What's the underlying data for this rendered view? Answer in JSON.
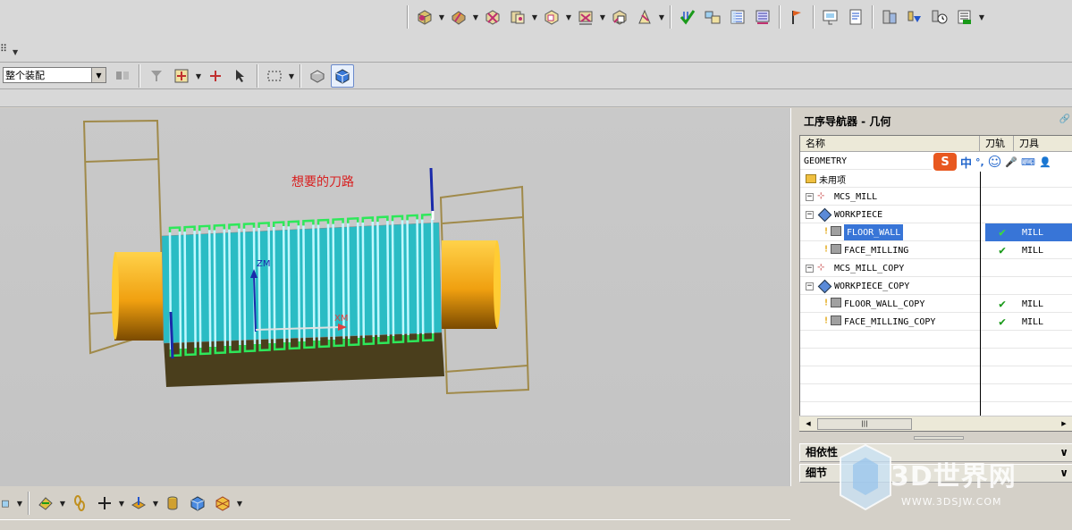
{
  "toolbar_top": {
    "icons": [
      "create-geometry-icon",
      "create-operation-icon",
      "delete-icon",
      "copy-icon",
      "insert-group-icon",
      "tool-icon",
      "method-icon",
      "cut-icon",
      "generate-toolpath-icon",
      "replay-toolpath-icon",
      "list-toolpath-icon",
      "postprocess-icon",
      "flag-icon",
      "shop-doc-icon",
      "output-doc-icon",
      "verify-icon",
      "simulate-icon",
      "clock-icon",
      "info-icon"
    ]
  },
  "toolbar_row2": {
    "assembly_selector_value": "整个装配"
  },
  "viewport": {
    "annotation": "想要的刀路",
    "axis_z": "ZM",
    "axis_x": "XM"
  },
  "navigator": {
    "title": "工序导航器 - 几何",
    "columns": {
      "name": "名称",
      "path": "刀轨",
      "tool": "刀具"
    },
    "ime": {
      "zh": "中",
      "punct": "°,"
    },
    "rows": [
      {
        "name": "GEOMETRY",
        "level": 0,
        "path": "",
        "tool": ""
      },
      {
        "name": "未用项",
        "level": 1,
        "path": "",
        "tool": ""
      },
      {
        "name": "MCS_MILL",
        "level": 1,
        "path": "",
        "tool": ""
      },
      {
        "name": "WORKPIECE",
        "level": 2,
        "path": "",
        "tool": ""
      },
      {
        "name": "FLOOR_WALL",
        "level": 3,
        "path": "✔",
        "tool": "MILL"
      },
      {
        "name": "FACE_MILLING",
        "level": 3,
        "path": "✔",
        "tool": "MILL"
      },
      {
        "name": "MCS_MILL_COPY",
        "level": 1,
        "path": "",
        "tool": ""
      },
      {
        "name": "WORKPIECE_COPY",
        "level": 2,
        "path": "",
        "tool": ""
      },
      {
        "name": "FLOOR_WALL_COPY",
        "level": 3,
        "path": "✔",
        "tool": "MILL"
      },
      {
        "name": "FACE_MILLING_COPY",
        "level": 3,
        "path": "✔",
        "tool": "MILL"
      }
    ],
    "section_dependencies": "相依性",
    "section_details": "细节"
  },
  "watermark": {
    "text": "3D世界网",
    "url": "WWW.3DSJW.COM"
  }
}
